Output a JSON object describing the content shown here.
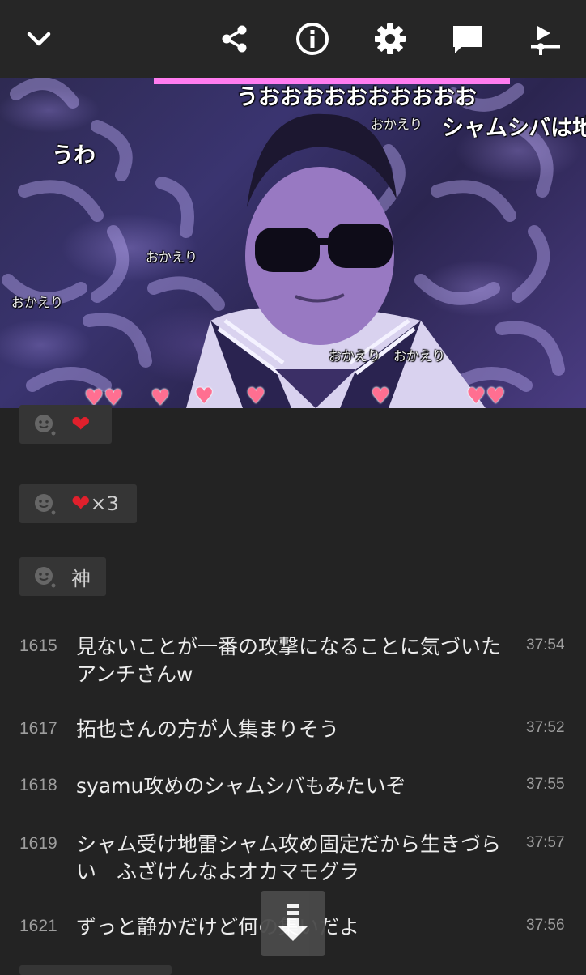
{
  "toolbar": {
    "icons": [
      "chevron-down-icon",
      "share-icon",
      "info-icon",
      "gear-icon",
      "comment-icon",
      "playlist-icon"
    ]
  },
  "video": {
    "overlay_comments": [
      "うおおおおおおおおおお",
      "シャムシバは地",
      "うわ",
      "おかえり",
      "おかえり",
      "おかえり",
      "おかえり",
      "おかえり"
    ],
    "hearts": [
      "♥♥",
      "♥",
      "♥",
      "♥",
      "♥",
      "♥♥"
    ]
  },
  "reactions": [
    {
      "text": "",
      "heart": "❤",
      "suffix": ""
    },
    {
      "text": "",
      "heart": "❤",
      "suffix": "×3"
    },
    {
      "text": "神",
      "heart": "",
      "suffix": ""
    }
  ],
  "comments": [
    {
      "no": "1615",
      "text": "見ないことが一番の攻撃になることに気づいたアンチさんw",
      "time": "37:54"
    },
    {
      "no": "1617",
      "text": "拓也さんの方が人集まりそう",
      "time": "37:52"
    },
    {
      "no": "1618",
      "text": "syamu攻めのシャムシバもみたいぞ",
      "time": "37:55"
    },
    {
      "no": "1619",
      "text": "シャム受け地雷シャム攻め固定だから生きづらい　ふざけんなよオカマモグラ",
      "time": "37:57"
    },
    {
      "no": "1621",
      "text": "ずっと静かだけど何の集いだよ",
      "time": "37:56"
    }
  ],
  "colors": {
    "background": "#232323",
    "chip": "#353535",
    "heart_red": "#e0202c"
  }
}
